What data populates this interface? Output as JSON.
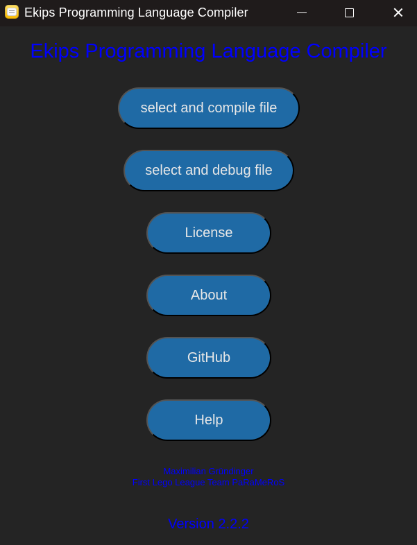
{
  "window": {
    "title": "Ekips Programming Language Compiler",
    "controls": {
      "minimize_icon": "minimize-icon",
      "maximize_icon": "maximize-icon",
      "close_icon": "close-icon"
    }
  },
  "main": {
    "title": "Ekips Programming Language Compiler",
    "buttons": [
      {
        "label": "select and compile file"
      },
      {
        "label": "select and debug file"
      },
      {
        "label": "License"
      },
      {
        "label": "About"
      },
      {
        "label": "GitHub"
      },
      {
        "label": "Help"
      }
    ]
  },
  "footer": {
    "author": "Maximilian Gründinger",
    "team": "First Lego League Team PaRaMeRoS",
    "version": "Version 2.2.2"
  },
  "colors": {
    "background": "#242424",
    "titlebar": "#1f1b1b",
    "accent_text": "#0000ff",
    "button": "#1f6aa5",
    "button_text": "#e7e7e7"
  }
}
